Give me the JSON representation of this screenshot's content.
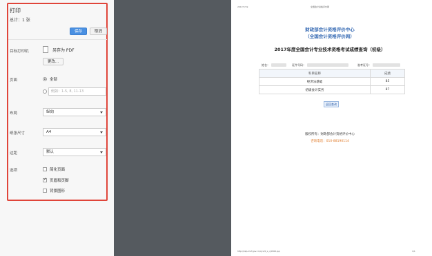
{
  "panel": {
    "title": "打印",
    "page_count": "总计：1 张",
    "save_label": "保存",
    "cancel_label": "取消",
    "destination_label": "目标打印机",
    "destination_value": "另存为 PDF",
    "change_label": "更改...",
    "pages_label": "页面",
    "pages_all": "全部",
    "pages_range_placeholder": "例如：1-5, 8, 11-13",
    "layout_label": "布局",
    "layout_value": "纵向",
    "paper_label": "纸张尺寸",
    "paper_value": "A4",
    "margins_label": "边距",
    "margins_value": "默认",
    "options_label": "选项",
    "option_simplify": "简化页面",
    "option_headers": "页眉和页脚",
    "option_background": "背景图形",
    "option_states": [
      false,
      true,
      false
    ]
  },
  "preview": {
    "header_date": "2017/7/19",
    "header_center": "全国会计资格评价网",
    "org_name": "财政部会计资格评价中心",
    "org_sub": "（全国会计资格评价网）",
    "exam_title": "2017年度全国会计专业技术资格考试成绩查询（初级）",
    "name_label": "姓名：",
    "id_label": "证件号码：",
    "admission_label": "准考证号：",
    "table_headers": [
      "科目名称",
      "成绩"
    ],
    "table_rows": [
      [
        "经济法基础",
        "85"
      ],
      [
        "初级会计实务",
        "87"
      ]
    ],
    "back_label": "返回查询",
    "copyright": "版权所有：财政部会计资格评价中心",
    "hotline": "咨询电话：010-88190114",
    "footer_url": "http://kzp.mof.gov.cn/cjcx/0_s_cj0300.jsp",
    "footer_page": "1/1"
  },
  "colors": {
    "highlight": "#e0453a",
    "primary": "#4a90e2",
    "title_blue": "#3a6db5",
    "hotline_orange": "#e07b2a",
    "gutter": "#555a5f"
  }
}
